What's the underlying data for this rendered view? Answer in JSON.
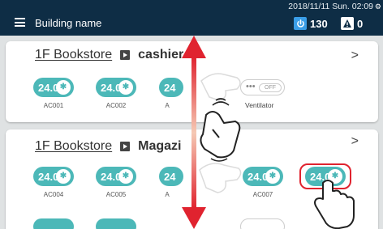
{
  "header": {
    "building_name": "Building name",
    "datetime": "2018/11/11 Sun. 02:09",
    "power_count": "130",
    "alert_count": "0"
  },
  "cards": [
    {
      "floor": "1F Bookstore",
      "zone": "cashier",
      "units": [
        {
          "temp": "24.0",
          "label": "AC001"
        },
        {
          "temp": "24.0",
          "label": "AC002"
        },
        {
          "temp": "24",
          "label": "A"
        }
      ],
      "ventilator": {
        "dots": "•••",
        "state": "OFF",
        "label": "Ventilator"
      }
    },
    {
      "floor": "1F Bookstore",
      "zone": "Magazi",
      "units": [
        {
          "temp": "24.0",
          "label": "AC004"
        },
        {
          "temp": "24.0",
          "label": "AC005"
        },
        {
          "temp": "24",
          "label": "A"
        },
        {
          "temp": "24.0",
          "label": "AC007"
        },
        {
          "temp": "24.0",
          "label": ""
        }
      ]
    }
  ],
  "colors": {
    "header_bg": "#0e2d45",
    "pill": "#4cb8b8",
    "selection": "#e0232f",
    "arrow": "#e0232f"
  },
  "icons": [
    "menu-icon",
    "power-icon",
    "alert-icon",
    "chevron-right-icon",
    "fan-mode-icon",
    "play-icon",
    "hand-pointer-icon",
    "double-arrow-icon"
  ]
}
